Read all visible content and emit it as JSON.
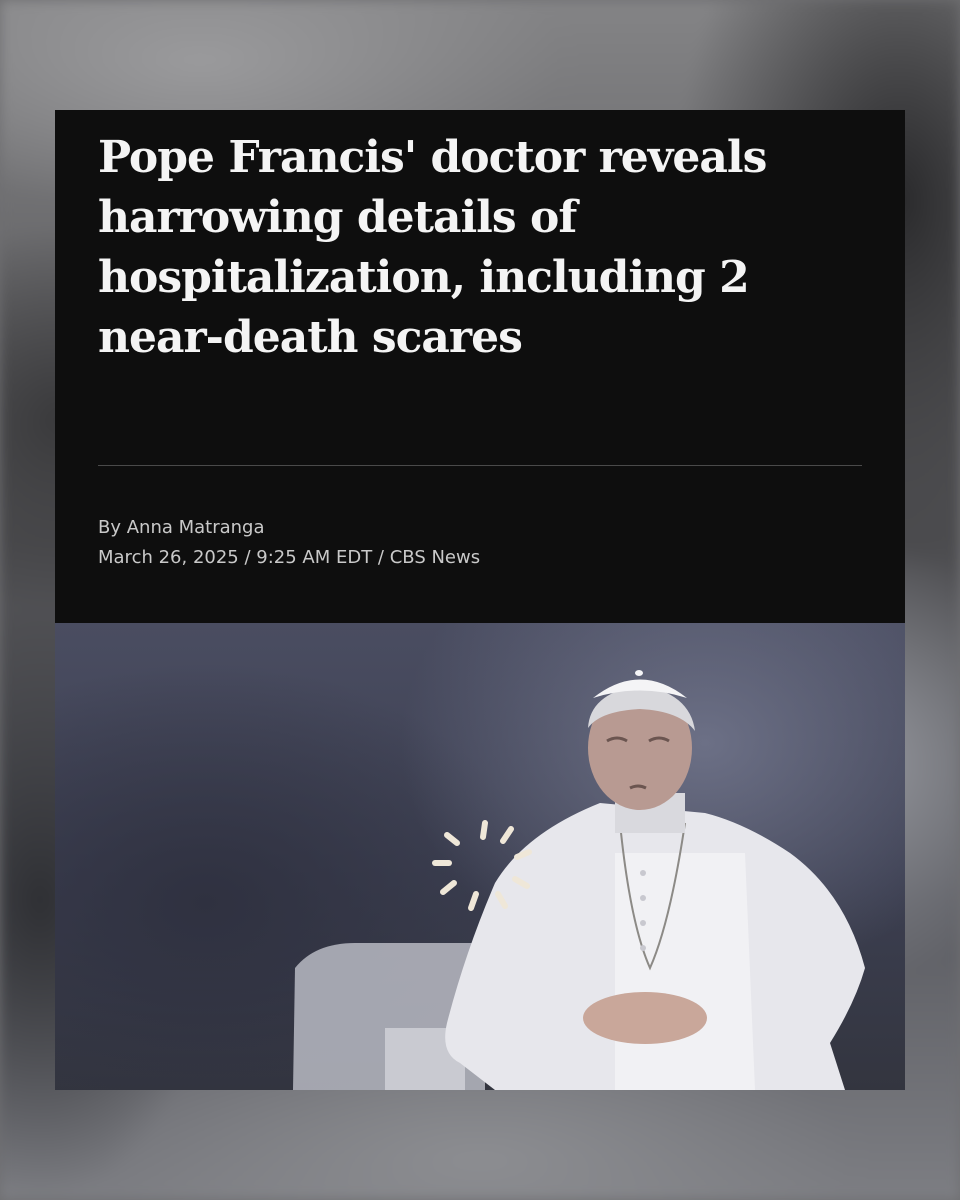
{
  "article": {
    "headline": "Pope Francis' doctor reveals harrowing details of hospitalization, including 2 near-death scares",
    "byline": "By Anna Matranga",
    "date": "March 26, 2025",
    "time": "9:25 AM EDT",
    "source": "CBS News",
    "separator": " / "
  },
  "media": {
    "photo_subject": "pope-francis-photo",
    "loading_indicator": "loading-spinner-icon"
  },
  "colors": {
    "header_bg": "#0e0e0e",
    "headline_text": "#f4f4f4",
    "meta_text": "#c9c9c9",
    "divider": "#4a4a4a"
  }
}
